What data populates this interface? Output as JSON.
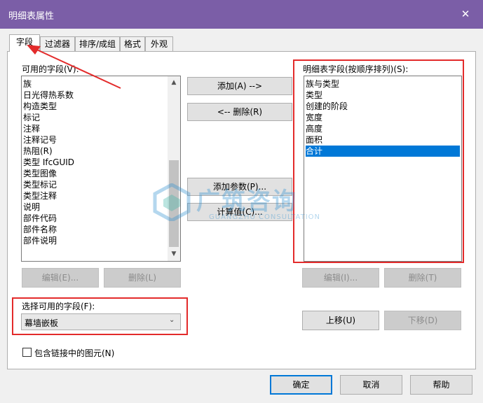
{
  "window": {
    "title": "明细表属性",
    "close_glyph": "✕"
  },
  "tabs": [
    {
      "label": "字段",
      "active": true
    },
    {
      "label": "过滤器",
      "active": false
    },
    {
      "label": "排序/成组",
      "active": false
    },
    {
      "label": "格式",
      "active": false
    },
    {
      "label": "外观",
      "active": false
    }
  ],
  "available_fields": {
    "label": "可用的字段(V):",
    "items": [
      "族",
      "日光得热系数",
      "构造类型",
      "标记",
      "注释",
      "注释记号",
      "热阻(R)",
      "类型 IfcGUID",
      "类型图像",
      "类型标记",
      "类型注释",
      "说明",
      "部件代码",
      "部件名称",
      "部件说明"
    ]
  },
  "scheduled_fields": {
    "label": "明细表字段(按顺序排列)(S):",
    "items": [
      "族与类型",
      "类型",
      "创建的阶段",
      "宽度",
      "高度",
      "面积",
      "合计"
    ],
    "selected_index": 6
  },
  "buttons": {
    "add": "添加(A) -->",
    "remove": "<-- 删除(R)",
    "add_parameter": "添加参数(P)...",
    "calculated_value": "计算值(C)...",
    "edit_left": "编辑(E)...",
    "delete_left": "删除(L)",
    "edit_right": "编辑(I)...",
    "delete_right": "删除(T)",
    "move_up": "上移(U)",
    "move_down": "下移(D)",
    "ok": "确定",
    "cancel": "取消",
    "help": "帮助"
  },
  "select_fields": {
    "label": "选择可用的字段(F):",
    "value": "幕墙嵌板"
  },
  "include_links": {
    "label": "包含链接中的图元(N)",
    "checked": false
  },
  "watermark": {
    "main": "广筑咨询",
    "sub": "GUANGZHU CONSULTATION"
  },
  "colors": {
    "titlebar": "#7B5EA7",
    "selection": "#0078D7",
    "annotation_red": "#E32B2B"
  }
}
